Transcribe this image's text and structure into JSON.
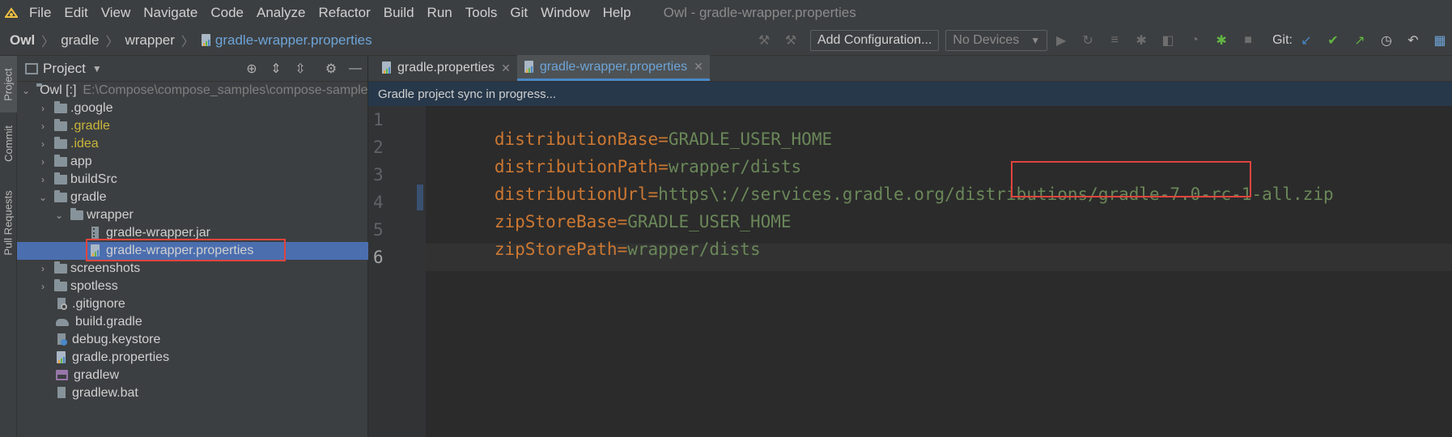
{
  "menubar": {
    "items": [
      {
        "label": "File"
      },
      {
        "label": "Edit"
      },
      {
        "label": "View"
      },
      {
        "label": "Navigate"
      },
      {
        "label": "Code"
      },
      {
        "label": "Analyze"
      },
      {
        "label": "Refactor"
      },
      {
        "label": "Build"
      },
      {
        "label": "Run"
      },
      {
        "label": "Tools"
      },
      {
        "label": "Git"
      },
      {
        "label": "Window"
      },
      {
        "label": "Help"
      }
    ],
    "window_title": "Owl - gradle-wrapper.properties"
  },
  "breadcrumb": {
    "items": [
      "Owl",
      "gradle",
      "wrapper",
      "gradle-wrapper.properties"
    ]
  },
  "toolbar": {
    "add_configuration": "Add Configuration...",
    "device_select": "No Devices",
    "git_label": "Git:"
  },
  "tool_stripe": {
    "tabs": [
      "Project",
      "Commit",
      "Pull Requests"
    ]
  },
  "project_panel": {
    "title": "Project",
    "tree": [
      {
        "name": "Owl [:]",
        "path": "E:\\Compose\\compose_samples\\compose-samples\\Owl"
      },
      {
        "name": ".google"
      },
      {
        "name": ".gradle"
      },
      {
        "name": ".idea"
      },
      {
        "name": "app"
      },
      {
        "name": "buildSrc"
      },
      {
        "name": "gradle"
      },
      {
        "name": "wrapper"
      },
      {
        "name": "gradle-wrapper.jar"
      },
      {
        "name": "gradle-wrapper.properties"
      },
      {
        "name": "screenshots"
      },
      {
        "name": "spotless"
      },
      {
        "name": ".gitignore"
      },
      {
        "name": "build.gradle"
      },
      {
        "name": "debug.keystore"
      },
      {
        "name": "gradle.properties"
      },
      {
        "name": "gradlew"
      },
      {
        "name": "gradlew.bat"
      }
    ]
  },
  "editor": {
    "tabs": [
      {
        "label": "gradle.properties"
      },
      {
        "label": "gradle-wrapper.properties"
      }
    ],
    "banner": "Gradle project sync in progress...",
    "lines": [
      {
        "no": "1",
        "key": "distributionBase",
        "eq": "=",
        "value": "GRADLE_USER_HOME"
      },
      {
        "no": "2",
        "key": "distributionPath",
        "eq": "=",
        "value": "wrapper/dists"
      },
      {
        "no": "3",
        "key": "distributionUrl",
        "eq": "=",
        "value": "https\\://services.gradle.org/distributions/gradle-7.0-rc-1-all.zip"
      },
      {
        "no": "4",
        "key": "zipStoreBase",
        "eq": "=",
        "value": "GRADLE_USER_HOME"
      },
      {
        "no": "5",
        "key": "zipStorePath",
        "eq": "=",
        "value": "wrapper/dists"
      },
      {
        "no": "6",
        "key": "",
        "eq": "",
        "value": ""
      }
    ]
  },
  "colors": {
    "key": "#cc7832",
    "value": "#6a8759",
    "selection": "#4b6eaf",
    "highlight_box": "#e0443e"
  }
}
